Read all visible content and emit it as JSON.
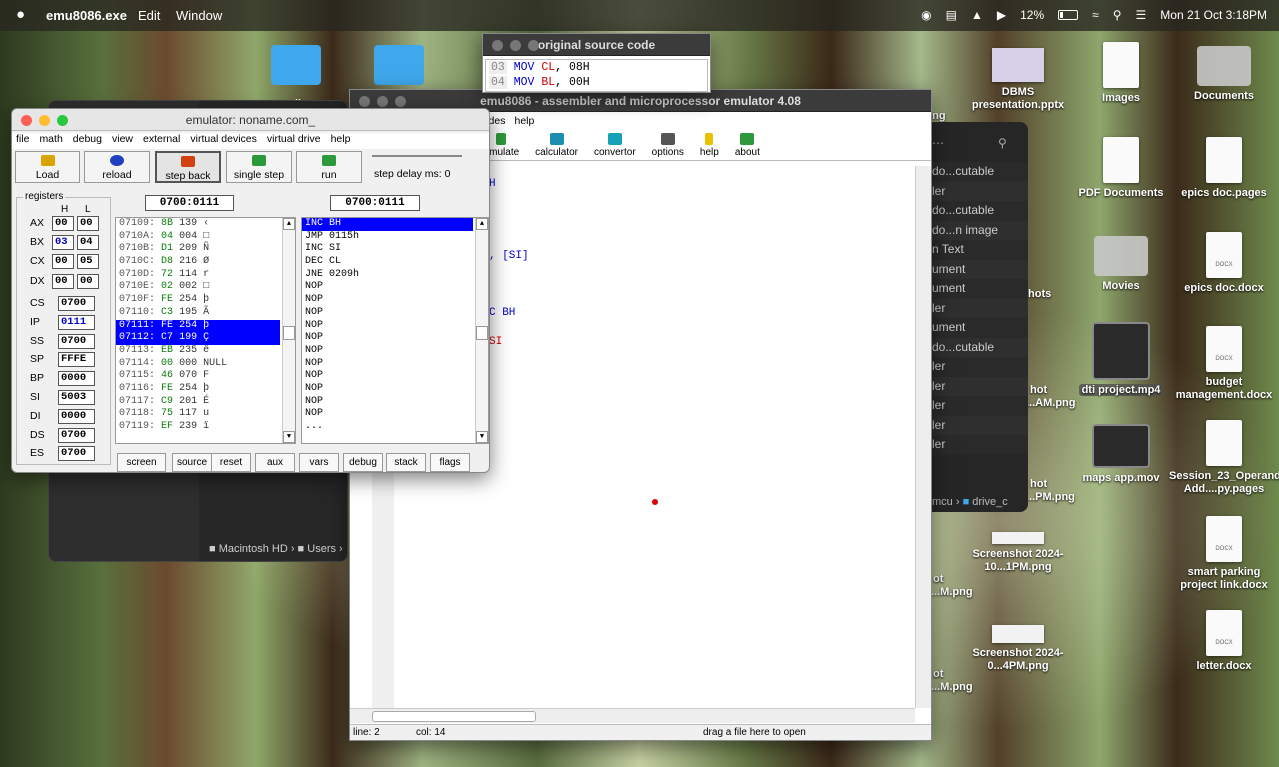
{
  "menubar": {
    "app": "emu8086.exe",
    "edit": "Edit",
    "window": "Window",
    "battery": "12%",
    "datetime": "Mon 21 Oct  3:18PM"
  },
  "desktop": {
    "folder1": "sil",
    "col1": [
      "DBMS presentation.pptx"
    ],
    "images": "Images",
    "documents": "Documents",
    "pdf": "PDF Documents",
    "epics_pages": "epics doc.pages",
    "movies": "Movies",
    "epics_docx": "epics doc.docx",
    "dti": "dti project.mp4",
    "budget": "budget management.docx",
    "maps": "maps app.mov",
    "session": "Session_23_Operands Add....py.pages",
    "shot1": "Screenshot 2024-10...1PM.png",
    "smart": "smart parking project link.docx",
    "shot2": "Screenshot 2024-0...4PM.png",
    "letter": "letter.docx",
    "partial": [
      "ot",
      "...M.png",
      "hots",
      "hot",
      "...AM.png",
      "hot",
      "...PM.png",
      "ot",
      "...M.png",
      "ot",
      "...M.png"
    ],
    "docx_tag": "DOCX"
  },
  "finder": {
    "path1": "Macintosh HD",
    "path2": "Users",
    "rows": [
      "do...cutable",
      "ler",
      "do...cutable",
      "do...n image",
      "n Text",
      "ument",
      "ument",
      "ler",
      "ument",
      "do...cutable",
      "ler",
      "ler",
      "ler",
      "ler",
      "ler"
    ],
    "foot1": "mcu",
    "foot2": "drive_c"
  },
  "source": {
    "title": "original source code",
    "lines": [
      {
        "n": "03",
        "op": "MOV",
        "reg": "CL",
        "val": ", 08H"
      },
      {
        "n": "04",
        "op": "MOV",
        "reg": "BL",
        "val": ", 00H"
      }
    ]
  },
  "editor": {
    "title": "emu8086 - assembler and microprocessor emulator 4.08",
    "menu": [
      "er",
      "emulator",
      "math",
      "ascii codes",
      "help"
    ],
    "tools": [
      "save",
      "compile",
      "emulate",
      "calculator",
      "convertor",
      "options",
      "help",
      "about"
    ],
    "code": [
      {
        "t": "H"
      },
      {
        "t": ", [SI]"
      },
      {
        "t": "C BH"
      },
      {
        "t": "SI"
      }
    ],
    "line": "line: 2",
    "col": "col: 14",
    "drag": "drag a file here to open"
  },
  "emu": {
    "title": "emulator: noname.com_",
    "menu": [
      "file",
      "math",
      "debug",
      "view",
      "external",
      "virtual devices",
      "virtual drive",
      "help"
    ],
    "buttons": [
      "Load",
      "reload",
      "step back",
      "single step",
      "run"
    ],
    "step_delay": "step delay ms: 0",
    "registers_label": "registers",
    "h": "H",
    "l": "L",
    "regs8": [
      {
        "n": "AX",
        "h": "00",
        "l": "00"
      },
      {
        "n": "BX",
        "h": "03",
        "l": "04"
      },
      {
        "n": "CX",
        "h": "00",
        "l": "05"
      },
      {
        "n": "DX",
        "h": "00",
        "l": "00"
      }
    ],
    "regs16": [
      {
        "n": "CS",
        "v": "0700"
      },
      {
        "n": "IP",
        "v": "0111"
      },
      {
        "n": "SS",
        "v": "0700"
      },
      {
        "n": "SP",
        "v": "FFFE"
      },
      {
        "n": "BP",
        "v": "0000"
      },
      {
        "n": "SI",
        "v": "5003"
      },
      {
        "n": "DI",
        "v": "0000"
      },
      {
        "n": "DS",
        "v": "0700"
      },
      {
        "n": "ES",
        "v": "0700"
      }
    ],
    "addr1": "0700:0111",
    "addr2": "0700:0111",
    "memory": [
      {
        "a": "07109:",
        "h": "8B",
        "d": "139",
        "c": "‹"
      },
      {
        "a": "0710A:",
        "h": "04",
        "d": "004",
        "c": "□"
      },
      {
        "a": "0710B:",
        "h": "D1",
        "d": "209",
        "c": "Ñ"
      },
      {
        "a": "0710C:",
        "h": "D8",
        "d": "216",
        "c": "Ø"
      },
      {
        "a": "0710D:",
        "h": "72",
        "d": "114",
        "c": "r"
      },
      {
        "a": "0710E:",
        "h": "02",
        "d": "002",
        "c": "□"
      },
      {
        "a": "0710F:",
        "h": "FE",
        "d": "254",
        "c": "þ"
      },
      {
        "a": "07110:",
        "h": "C3",
        "d": "195",
        "c": "Ã"
      },
      {
        "a": "07111:",
        "h": "FE",
        "d": "254",
        "c": "þ"
      },
      {
        "a": "07112:",
        "h": "C7",
        "d": "199",
        "c": "Ç"
      },
      {
        "a": "07113:",
        "h": "EB",
        "d": "235",
        "c": "ë"
      },
      {
        "a": "07114:",
        "h": "00",
        "d": "000",
        "c": "NULL"
      },
      {
        "a": "07115:",
        "h": "46",
        "d": "070",
        "c": "F"
      },
      {
        "a": "07116:",
        "h": "FE",
        "d": "254",
        "c": "þ"
      },
      {
        "a": "07117:",
        "h": "C9",
        "d": "201",
        "c": "É"
      },
      {
        "a": "07118:",
        "h": "75",
        "d": "117",
        "c": "u"
      },
      {
        "a": "07119:",
        "h": "EF",
        "d": "239",
        "c": "ï"
      }
    ],
    "disasm": [
      "INC BH",
      "JMP 0115h",
      "INC SI",
      "DEC CL",
      "JNE 0209h",
      "NOP",
      "NOP",
      "NOP",
      "NOP",
      "NOP",
      "NOP",
      "NOP",
      "NOP",
      "NOP",
      "NOP",
      "NOP",
      "..."
    ],
    "bottom": [
      "screen",
      "source",
      "reset",
      "aux",
      "vars",
      "debug",
      "stack",
      "flags"
    ]
  }
}
